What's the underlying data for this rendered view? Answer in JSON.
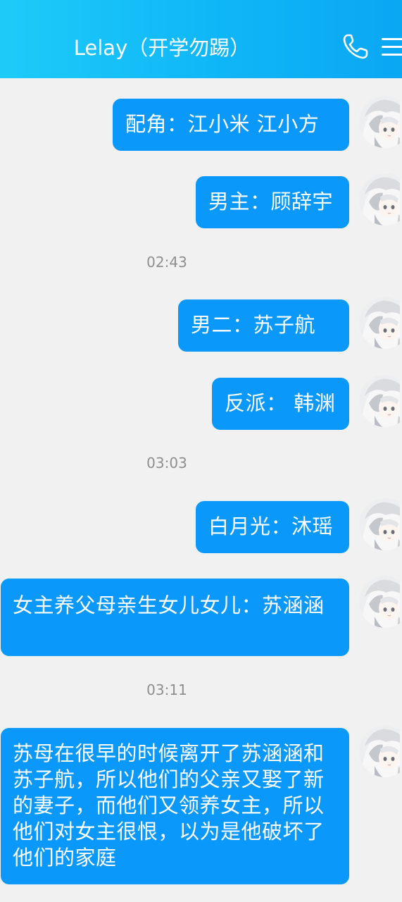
{
  "header": {
    "title": "Lelay（开学勿踢）",
    "phone_icon": "phone-icon",
    "menu_icon": "menu-icon",
    "color_start": "#1ecbf8",
    "color_end": "#0aa7f3"
  },
  "colors": {
    "bubble": "#0a99fa",
    "background": "#f1f1f1",
    "timestamp": "#8e8e8e"
  },
  "messages": [
    {
      "type": "message",
      "text": "配角：江小米   江小方"
    },
    {
      "type": "message",
      "text": "男主：顾辞宇"
    },
    {
      "type": "timestamp",
      "text": "02:43"
    },
    {
      "type": "message",
      "text": "男二：苏子航"
    },
    {
      "type": "message",
      "text": "反派： 韩渊"
    },
    {
      "type": "timestamp",
      "text": "03:03"
    },
    {
      "type": "message",
      "text": "白月光：沐瑶"
    },
    {
      "type": "message",
      "text": "女主养父母亲生女儿女儿：苏涵涵"
    },
    {
      "type": "timestamp",
      "text": "03:11"
    },
    {
      "type": "message",
      "text": "苏母在很早的时候离开了苏涵涵和苏子航，所以他们的父亲又娶了新的妻子，而他们又领养女主，所以他们对女主很恨，以为是他破坏了他们的家庭"
    }
  ]
}
